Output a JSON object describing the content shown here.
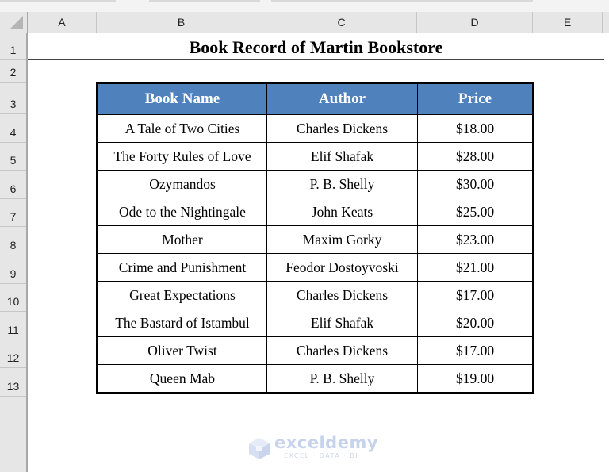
{
  "spreadsheet": {
    "column_headers": [
      "A",
      "B",
      "C",
      "D",
      "E"
    ],
    "row_headers": [
      "1",
      "2",
      "3",
      "4",
      "5",
      "6",
      "7",
      "8",
      "9",
      "10",
      "11",
      "12",
      "13"
    ],
    "title": "Book Record of Martin Bookstore"
  },
  "table": {
    "headers": [
      "Book Name",
      "Author",
      "Price"
    ],
    "header_color": "#4f81bd",
    "rows": [
      {
        "book": "A Tale of Two Cities",
        "author": "Charles Dickens",
        "price": "$18.00"
      },
      {
        "book": "The Forty Rules of Love",
        "author": "Elif Shafak",
        "price": "$28.00"
      },
      {
        "book": "Ozymandos",
        "author": "P. B. Shelly",
        "price": "$30.00"
      },
      {
        "book": "Ode to the Nightingale",
        "author": "John Keats",
        "price": "$25.00"
      },
      {
        "book": "Mother",
        "author": "Maxim Gorky",
        "price": "$23.00"
      },
      {
        "book": "Crime and Punishment",
        "author": "Feodor Dostoyvoski",
        "price": "$21.00"
      },
      {
        "book": "Great Expectations",
        "author": "Charles Dickens",
        "price": "$17.00"
      },
      {
        "book": "The Bastard of Istambul",
        "author": "Elif Shafak",
        "price": "$20.00"
      },
      {
        "book": "Oliver Twist",
        "author": "Charles Dickens",
        "price": "$17.00"
      },
      {
        "book": "Queen Mab",
        "author": "P. B. Shelly",
        "price": "$19.00"
      }
    ]
  },
  "watermark": {
    "name": "exceldemy",
    "tagline": "EXCEL · DATA · BI",
    "icon": "exceldemy-logo-icon"
  }
}
